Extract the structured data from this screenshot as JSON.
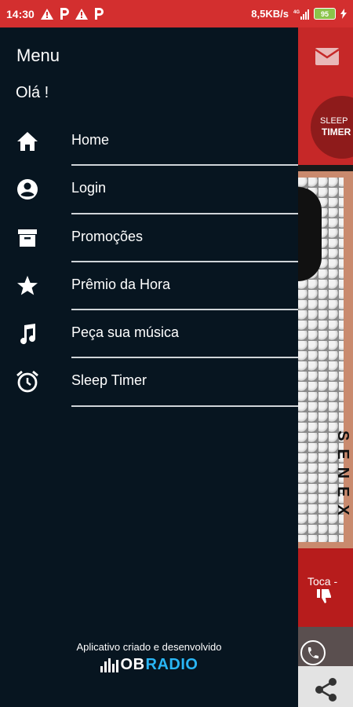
{
  "status_bar": {
    "time": "14:30",
    "speed": "8,5KB/s",
    "network": "4G",
    "battery": "95",
    "bg_color": "#d32f2f"
  },
  "drawer": {
    "title": "Menu",
    "greeting": "Olá !",
    "bg_color": "#071520",
    "items": [
      {
        "label": "Home",
        "icon": "home-icon"
      },
      {
        "label": "Login",
        "icon": "account-icon"
      },
      {
        "label": "Promoções",
        "icon": "archive-icon"
      },
      {
        "label": "Prêmio da Hora",
        "icon": "star-icon"
      },
      {
        "label": "Peça sua música",
        "icon": "music-note-icon"
      },
      {
        "label": "Sleep Timer",
        "icon": "alarm-clock-icon"
      }
    ],
    "footer": {
      "text": "Aplicativo criado e desenvolvido",
      "brand_part1": "OB",
      "brand_part2": "RADIO",
      "brand_accent": "#29b6f6"
    }
  },
  "background_app": {
    "logo_line1": "SLEEP",
    "logo_line2": "TIMER",
    "cover_side_text": "SENEX",
    "toca_label": "Toca -",
    "accent_color": "#c62828"
  }
}
